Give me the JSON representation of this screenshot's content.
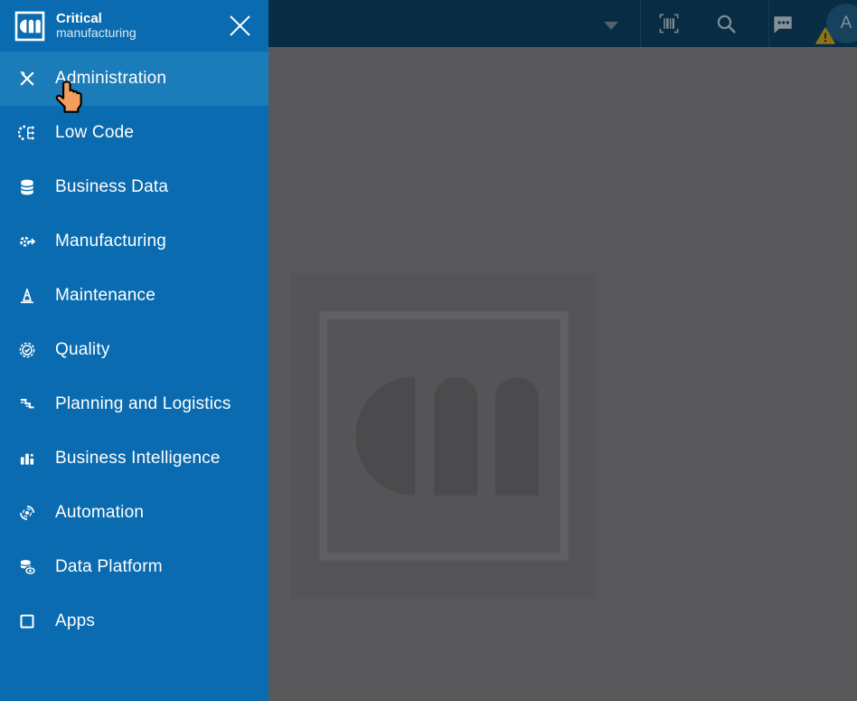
{
  "brand": {
    "title_bold": "Critical",
    "title_light": "manufacturing"
  },
  "sidebar": {
    "active_item": "Administration",
    "items": [
      {
        "label": "Administration",
        "icon": "tools-icon",
        "active": true
      },
      {
        "label": "Low Code",
        "icon": "low-code-icon",
        "active": false
      },
      {
        "label": "Business Data",
        "icon": "database-icon",
        "active": false
      },
      {
        "label": "Manufacturing",
        "icon": "gear-arrow-icon",
        "active": false
      },
      {
        "label": "Maintenance",
        "icon": "traffic-cone-icon",
        "active": false
      },
      {
        "label": "Quality",
        "icon": "quality-seal-icon",
        "active": false
      },
      {
        "label": "Planning and Logistics",
        "icon": "steps-icon",
        "active": false
      },
      {
        "label": "Business Intelligence",
        "icon": "bar-chart-icon",
        "active": false
      },
      {
        "label": "Automation",
        "icon": "automation-icon",
        "active": false
      },
      {
        "label": "Data Platform",
        "icon": "data-eye-icon",
        "active": false
      },
      {
        "label": "Apps",
        "icon": "apps-icon",
        "active": false
      }
    ]
  },
  "topbar": {
    "avatar_letter": "A",
    "warning_mark": "!",
    "icons": [
      "caret-down-icon",
      "barcode-scan-icon",
      "search-icon",
      "chat-icon",
      "avatar"
    ]
  },
  "colors": {
    "sidebar_blue": "#0a6bb0",
    "active_item_blue": "#1b7cba",
    "topbar_navy": "#072c44",
    "dim_gray": "#59595b",
    "watermark_card": "#555557",
    "watermark_glyph": "#4b4b4d",
    "warning_gold": "#8f7118",
    "cursor_orange": "#f49d5c"
  }
}
